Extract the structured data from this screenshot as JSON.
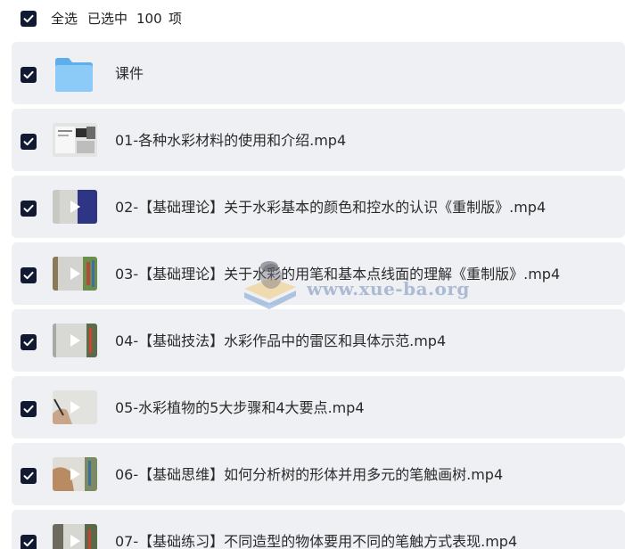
{
  "header": {
    "select_all_label": "全选",
    "selected_prefix": "已选中",
    "selected_count": "100",
    "selected_suffix": "项"
  },
  "items": [
    {
      "name": "课件",
      "type": "folder",
      "icon": "folder-icon",
      "checked": true
    },
    {
      "name": "01-各种水彩材料的使用和介绍.mp4",
      "type": "video",
      "icon": "video-thumbnail",
      "checked": true
    },
    {
      "name": "02-【基础理论】关于水彩基本的颜色和控水的认识《重制版》.mp4",
      "type": "video",
      "icon": "video-thumbnail",
      "checked": true
    },
    {
      "name": "03-【基础理论】关于水彩的用笔和基本点线面的理解《重制版》.mp4",
      "type": "video",
      "icon": "video-thumbnail",
      "checked": true
    },
    {
      "name": "04-【基础技法】水彩作品中的雷区和具体示范.mp4",
      "type": "video",
      "icon": "video-thumbnail",
      "checked": true
    },
    {
      "name": "05-水彩植物的5大步骤和4大要点.mp4",
      "type": "video",
      "icon": "video-thumbnail",
      "checked": true
    },
    {
      "name": "06-【基础思维】如何分析树的形体并用多元的笔触画树.mp4",
      "type": "video",
      "icon": "video-thumbnail",
      "checked": true
    },
    {
      "name": "07-【基础练习】不同造型的物体要用不同的笔触方式表现.mp4",
      "type": "video",
      "icon": "video-thumbnail",
      "checked": true
    }
  ],
  "watermark": {
    "text": "www.xue-ba.org"
  },
  "colors": {
    "checkbox": "#121a33",
    "row_background": "#eff0f3",
    "text": "#2b2b2b",
    "folder": "#7cc0f5"
  }
}
